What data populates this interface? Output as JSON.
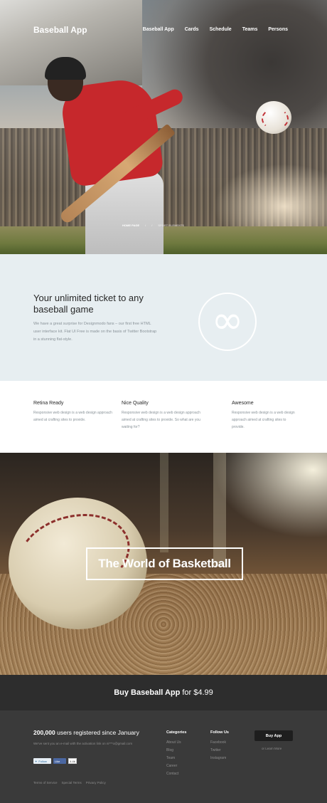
{
  "header": {
    "brand": "Baseball App",
    "nav": [
      "Baseball App",
      "Cards",
      "Schedule",
      "Teams",
      "Persons"
    ]
  },
  "breadcrumbs": [
    "HOME PAGE",
    "/",
    "/",
    "SPORT ELEMENTS"
  ],
  "intro": {
    "title": "Your unlimited ticket to any baseball game",
    "text": "We have a great surprise for Designmodo fans – our first free HTML user interface kit. Flat UI Free is made on the basis of Twitter Bootstrap in a stunning flat-style.",
    "icon": "infinity-icon"
  },
  "features": [
    {
      "title": "Retina Ready",
      "text": "Responsive web design is a web design approach aimed at crafting sites to provide."
    },
    {
      "title": "Nice Quality",
      "text": "Responsive web design is a web design approach aimed at crafting sites to provide. So what are you waiting for?"
    },
    {
      "title": "Awesome",
      "text": "Responsive web design is a web design approach aimed at crafting sites to provide."
    }
  ],
  "banner": {
    "title": "The World of Basketball"
  },
  "buybar": {
    "bold": "Buy Baseball App",
    "rest": "for $4.99"
  },
  "footer": {
    "stat_bold": "200,000",
    "stat_rest": "users registered since January",
    "note": "We've sent you an e-mail with the activation link on ni***o@gmail.com",
    "socials": {
      "twitter": "Follow",
      "facebook": "Like",
      "count": "4.4k"
    },
    "legal": [
      "Terms of Service",
      "Special Terms",
      "Privacy Policy"
    ],
    "categories": {
      "title": "Categories",
      "items": [
        "About Us",
        "Blog",
        "Team",
        "Career",
        "Contact"
      ]
    },
    "follow": {
      "title": "Follow Us",
      "items": [
        "Facebook",
        "Twitter",
        "Instagram"
      ]
    },
    "buy_button": "Buy App",
    "learn_more": "or Learn More"
  }
}
